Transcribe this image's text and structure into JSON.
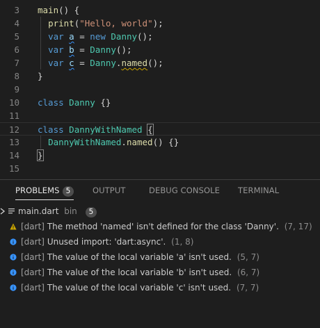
{
  "editor": {
    "lines": [
      {
        "num": "3",
        "parts": [
          {
            "t": "main",
            "c": "fn"
          },
          {
            "t": "() {",
            "c": "txt"
          }
        ]
      },
      {
        "num": "4",
        "parts": [
          {
            "t": "  ",
            "c": "txt"
          },
          {
            "t": "print",
            "c": "fn"
          },
          {
            "t": "(",
            "c": "txt"
          },
          {
            "t": "\"Hello, world\"",
            "c": "str"
          },
          {
            "t": ");",
            "c": "txt"
          }
        ]
      },
      {
        "num": "5",
        "parts": [
          {
            "t": "  ",
            "c": "txt"
          },
          {
            "t": "var",
            "c": "kw"
          },
          {
            "t": " ",
            "c": "txt"
          },
          {
            "t": "a",
            "c": "var",
            "sq": "info"
          },
          {
            "t": " = ",
            "c": "txt"
          },
          {
            "t": "new",
            "c": "kw"
          },
          {
            "t": " ",
            "c": "txt"
          },
          {
            "t": "Danny",
            "c": "cls"
          },
          {
            "t": "();",
            "c": "txt"
          }
        ]
      },
      {
        "num": "6",
        "parts": [
          {
            "t": "  ",
            "c": "txt"
          },
          {
            "t": "var",
            "c": "kw"
          },
          {
            "t": " ",
            "c": "txt"
          },
          {
            "t": "b",
            "c": "var",
            "sq": "info"
          },
          {
            "t": " = ",
            "c": "txt"
          },
          {
            "t": "Danny",
            "c": "cls"
          },
          {
            "t": "();",
            "c": "txt"
          }
        ]
      },
      {
        "num": "7",
        "parts": [
          {
            "t": "  ",
            "c": "txt"
          },
          {
            "t": "var",
            "c": "kw"
          },
          {
            "t": " ",
            "c": "txt"
          },
          {
            "t": "c",
            "c": "var",
            "sq": "info"
          },
          {
            "t": " = ",
            "c": "txt"
          },
          {
            "t": "Danny",
            "c": "cls"
          },
          {
            "t": ".",
            "c": "txt"
          },
          {
            "t": "named",
            "c": "fn",
            "sq": "warn"
          },
          {
            "t": "();",
            "c": "txt"
          }
        ]
      },
      {
        "num": "8",
        "parts": [
          {
            "t": "}",
            "c": "txt"
          }
        ]
      },
      {
        "num": "9",
        "parts": []
      },
      {
        "num": "10",
        "parts": [
          {
            "t": "class",
            "c": "kw"
          },
          {
            "t": " ",
            "c": "txt"
          },
          {
            "t": "Danny",
            "c": "cls"
          },
          {
            "t": " {}",
            "c": "txt"
          }
        ]
      },
      {
        "num": "11",
        "parts": []
      },
      {
        "num": "12",
        "current": true,
        "parts": [
          {
            "t": "class",
            "c": "kw"
          },
          {
            "t": " ",
            "c": "txt"
          },
          {
            "t": "DannyWithNamed",
            "c": "cls"
          },
          {
            "t": " ",
            "c": "txt"
          },
          {
            "t": "{",
            "c": "txt",
            "box": true
          }
        ]
      },
      {
        "num": "13",
        "parts": [
          {
            "t": "  ",
            "c": "txt"
          },
          {
            "t": "DannyWithNamed",
            "c": "cls"
          },
          {
            "t": ".",
            "c": "txt"
          },
          {
            "t": "named",
            "c": "fn"
          },
          {
            "t": "() {}",
            "c": "txt"
          }
        ]
      },
      {
        "num": "14",
        "parts": [
          {
            "t": "}",
            "c": "txt",
            "box": true
          }
        ]
      },
      {
        "num": "15",
        "parts": []
      }
    ]
  },
  "panel": {
    "tabs": [
      {
        "label": "PROBLEMS",
        "badge": "5",
        "active": true
      },
      {
        "label": "OUTPUT"
      },
      {
        "label": "DEBUG CONSOLE"
      },
      {
        "label": "TERMINAL"
      }
    ],
    "file": {
      "name": "main.dart",
      "folder": "bin",
      "count": "5"
    },
    "problems": [
      {
        "severity": "warning",
        "icon": "warning-icon",
        "source": "[dart]",
        "message": "The method 'named' isn't defined for the class 'Danny'.",
        "location": "(7, 17)"
      },
      {
        "severity": "info",
        "icon": "info-icon",
        "source": "[dart]",
        "message": "Unused import: 'dart:async'.",
        "location": "(1, 8)"
      },
      {
        "severity": "info",
        "icon": "info-icon",
        "source": "[dart]",
        "message": "The value of the local variable 'a' isn't used.",
        "location": "(5, 7)"
      },
      {
        "severity": "info",
        "icon": "info-icon",
        "source": "[dart]",
        "message": "The value of the local variable 'b' isn't used.",
        "location": "(6, 7)"
      },
      {
        "severity": "info",
        "icon": "info-icon",
        "source": "[dart]",
        "message": "The value of the local variable 'c' isn't used.",
        "location": "(7, 7)"
      }
    ]
  },
  "colors": {
    "warning": "#cca700",
    "info": "#3794ff",
    "accent": "#e7e7e7"
  }
}
